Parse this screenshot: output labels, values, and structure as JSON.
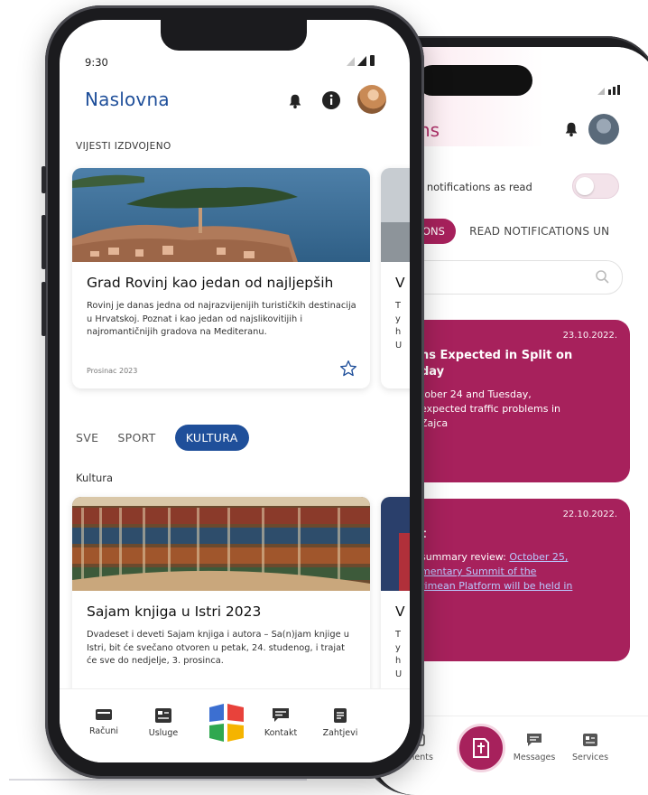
{
  "front": {
    "status_time": "9:30",
    "title": "Naslovna",
    "featured_label": "VIJESTI IZDVOJENO",
    "featured_card": {
      "title": "Grad Rovinj kao jedan od najljepših",
      "description": "Rovinj je danas jedna od najrazvijenijih turističkih destinacija u Hrvatskoj. Poznat i kao jedan od najslikovitijih i najromantičnijih gradova na Mediteranu.",
      "date": "Prosinac 2023"
    },
    "featured_peek": {
      "title_initial": "V",
      "desc_initials": "T\ny\nh\nU"
    },
    "chips": [
      "SVE",
      "SPORT",
      "KULTURA"
    ],
    "category_label": "Kultura",
    "category_card": {
      "title": "Sajam knjiga u Istri 2023",
      "description": "Dvadeset i deveti Sajam knjiga i autora – Sa(n)jam knjige u Istri, bit će svečano otvoren u petak, 24. studenog, i trajat će sve do nedjelje, 3. prosinca."
    },
    "category_peek": {
      "title_initial": "V",
      "desc_initials": "T\ny\nh\nU"
    },
    "nav": [
      "Računi",
      "Usluge",
      "Kontakt",
      "Zahtjevi"
    ]
  },
  "back": {
    "title": "ns",
    "mark_all_label": "l notifications as read",
    "tab_active": "ONS",
    "tab_other": "READ NOTIFICATIONS  UN",
    "notifications": [
      {
        "date": "23.10.2022.",
        "title": "ns Expected in Split on\nday",
        "body": "tober 24 and Tuesday,\nexpected traffic problems in\nZajca"
      },
      {
        "date": "22.10.2022.",
        "title": "t",
        "body_plain": "summary review: ",
        "body_link": "October 25,\nmentary Summit of the\nrimean Platform will be held in"
      }
    ],
    "nav": [
      "uments",
      "Messages",
      "Services"
    ]
  },
  "colors": {
    "brand_blue": "#1f4f9a",
    "brand_magenta": "#a7215c"
  }
}
